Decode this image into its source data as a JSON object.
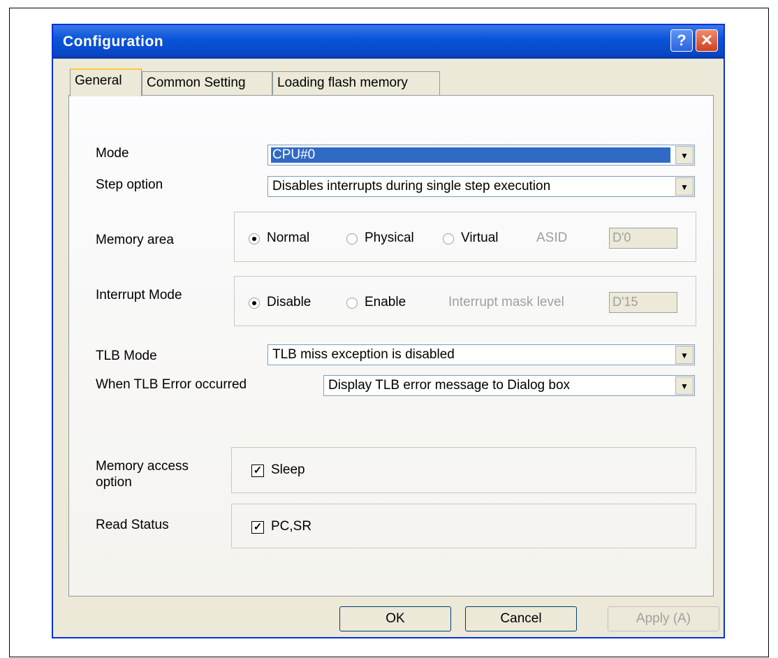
{
  "window": {
    "title": "Configuration",
    "help_icon": "?",
    "close_icon": "✕"
  },
  "tabs": [
    {
      "label": "General"
    },
    {
      "label": "Common Setting"
    },
    {
      "label": "Loading flash memory"
    }
  ],
  "general": {
    "mode": {
      "label": "Mode",
      "value": "CPU#0"
    },
    "step_option": {
      "label": "Step option",
      "value": "Disables interrupts during single step execution"
    },
    "memory_area": {
      "label": "Memory area",
      "options": [
        "Normal",
        "Physical",
        "Virtual"
      ],
      "selected": "Normal",
      "asid_label": "ASID",
      "asid_value": "D'0"
    },
    "interrupt_mode": {
      "label": "Interrupt Mode",
      "options": [
        "Disable",
        "Enable"
      ],
      "selected": "Disable",
      "mask_label": "Interrupt mask level",
      "mask_value": "D'15"
    },
    "tlb_mode": {
      "label": "TLB Mode",
      "value": "TLB miss exception is disabled"
    },
    "tlb_error": {
      "label": "When TLB Error occurred",
      "value": "Display TLB error message to Dialog box"
    },
    "memory_access": {
      "label_line1": "Memory access",
      "label_line2": "option",
      "checkbox_label": "Sleep",
      "checked": true
    },
    "read_status": {
      "label": "Read Status",
      "checkbox_label": "PC,SR",
      "checked": true
    }
  },
  "buttons": {
    "ok": "OK",
    "cancel": "Cancel",
    "apply": "Apply (A)"
  }
}
